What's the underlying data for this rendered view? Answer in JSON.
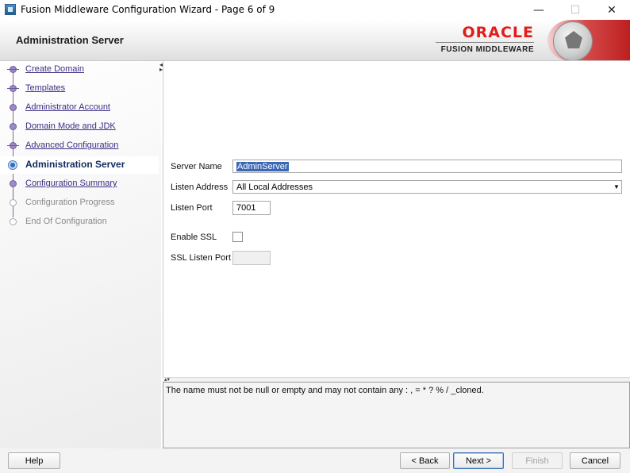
{
  "window": {
    "title": "Fusion Middleware Configuration Wizard - Page 6 of 9",
    "minimize_glyph": "—",
    "maximize_glyph": "☐",
    "close_glyph": "✕"
  },
  "header": {
    "page_title": "Administration Server",
    "brand_word": "ORACLE",
    "brand_subtitle": "FUSION MIDDLEWARE",
    "brand_color": "#e21d19"
  },
  "nav": {
    "items": [
      {
        "label": "Create Domain",
        "state": "done"
      },
      {
        "label": "Templates",
        "state": "done"
      },
      {
        "label": "Administrator Account",
        "state": "visited"
      },
      {
        "label": "Domain Mode and JDK",
        "state": "visited"
      },
      {
        "label": "Advanced Configuration",
        "state": "done"
      },
      {
        "label": "Administration Server",
        "state": "current"
      },
      {
        "label": "Configuration Summary",
        "state": "next"
      },
      {
        "label": "Configuration Progress",
        "state": "future"
      },
      {
        "label": "End Of Configuration",
        "state": "future"
      }
    ]
  },
  "form": {
    "server_name_label": "Server Name",
    "server_name_value": "AdminServer",
    "listen_address_label": "Listen Address",
    "listen_address_value": "All Local Addresses",
    "listen_port_label": "Listen Port",
    "listen_port_value": "7001",
    "enable_ssl_label": "Enable SSL",
    "enable_ssl_checked": false,
    "ssl_listen_port_label": "SSL Listen Port",
    "ssl_listen_port_value": ""
  },
  "message": {
    "text": "The name must not be null or empty and may not contain any : , = * ? % / _cloned."
  },
  "footer": {
    "help": "Help",
    "back": "< Back",
    "next": "Next >",
    "finish": "Finish",
    "cancel": "Cancel"
  }
}
